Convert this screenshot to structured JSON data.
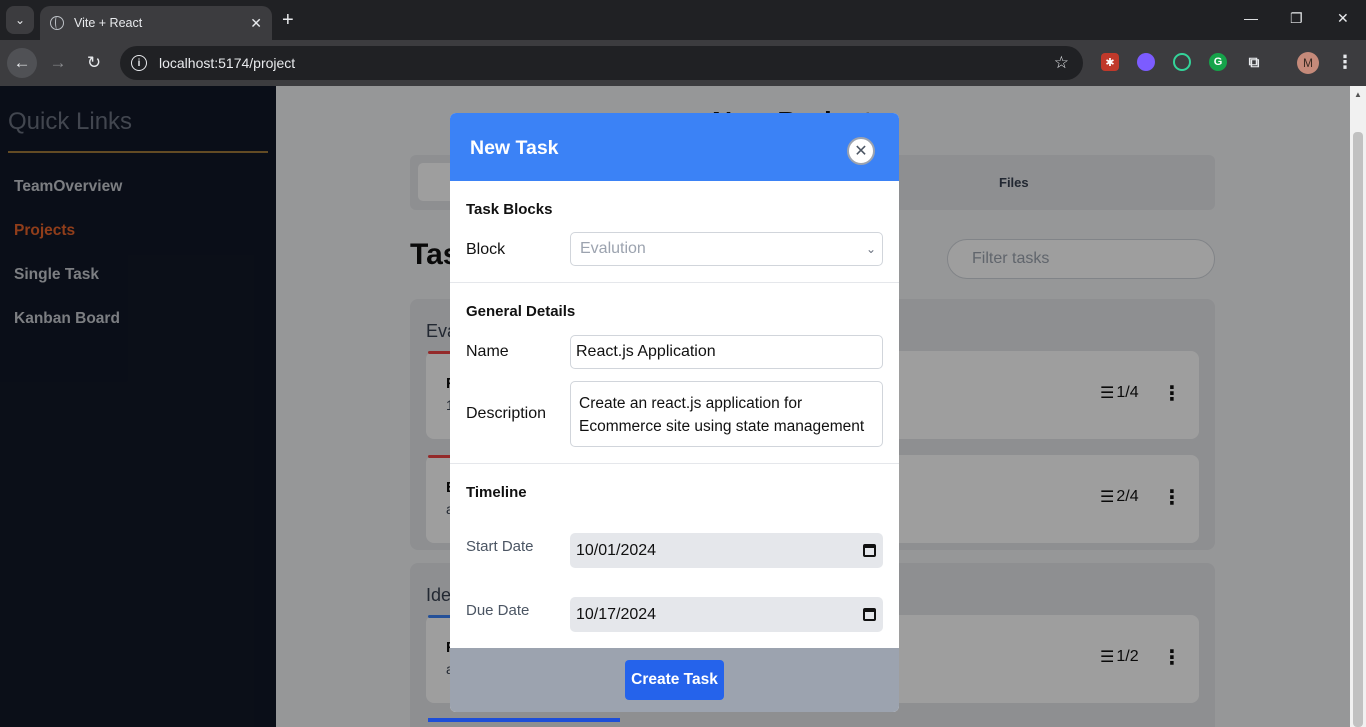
{
  "browser": {
    "tab_title": "Vite + React",
    "url": "localhost:5174/project",
    "profile_initial": "M"
  },
  "sidebar": {
    "title": "Quick Links",
    "items": [
      {
        "label": "TeamOverview",
        "active": false
      },
      {
        "label": "Projects",
        "active": true
      },
      {
        "label": "Single Task",
        "active": false
      },
      {
        "label": "Kanban Board",
        "active": false
      }
    ]
  },
  "main": {
    "title": "New Project",
    "tabs_right": "Files",
    "tasks_heading": "Tasks",
    "filter_placeholder": "Filter tasks",
    "groups": [
      {
        "title": "Evalution",
        "cards": [
          {
            "title": "R",
            "subtitle": "1",
            "subtasks": "1/4"
          },
          {
            "title": "E",
            "subtitle": "a",
            "subtasks": "2/4"
          }
        ]
      },
      {
        "title": "Ide",
        "cards": [
          {
            "title": "F",
            "subtitle": "a",
            "subtasks": "1/2"
          }
        ]
      }
    ]
  },
  "modal": {
    "title": "New Task",
    "close_icon": "close-icon",
    "section_blocks": "Task Blocks",
    "block_label": "Block",
    "block_value": "Evalution",
    "section_general": "General Details",
    "name_label": "Name",
    "name_value": "React.js Application",
    "description_label": "Description",
    "description_value": "Create an react.js application for Ecommerce site using state management",
    "section_timeline": "Timeline",
    "start_label": "Start Date",
    "start_value": "10/01/2024",
    "due_label": "Due Date",
    "due_value": "10/17/2024",
    "submit_label": "Create Task"
  },
  "colors": {
    "modal_header": "#3b82f6",
    "submit_button": "#2563eb",
    "sidebar_bg": "#111827",
    "active_link": "#e8632b"
  }
}
